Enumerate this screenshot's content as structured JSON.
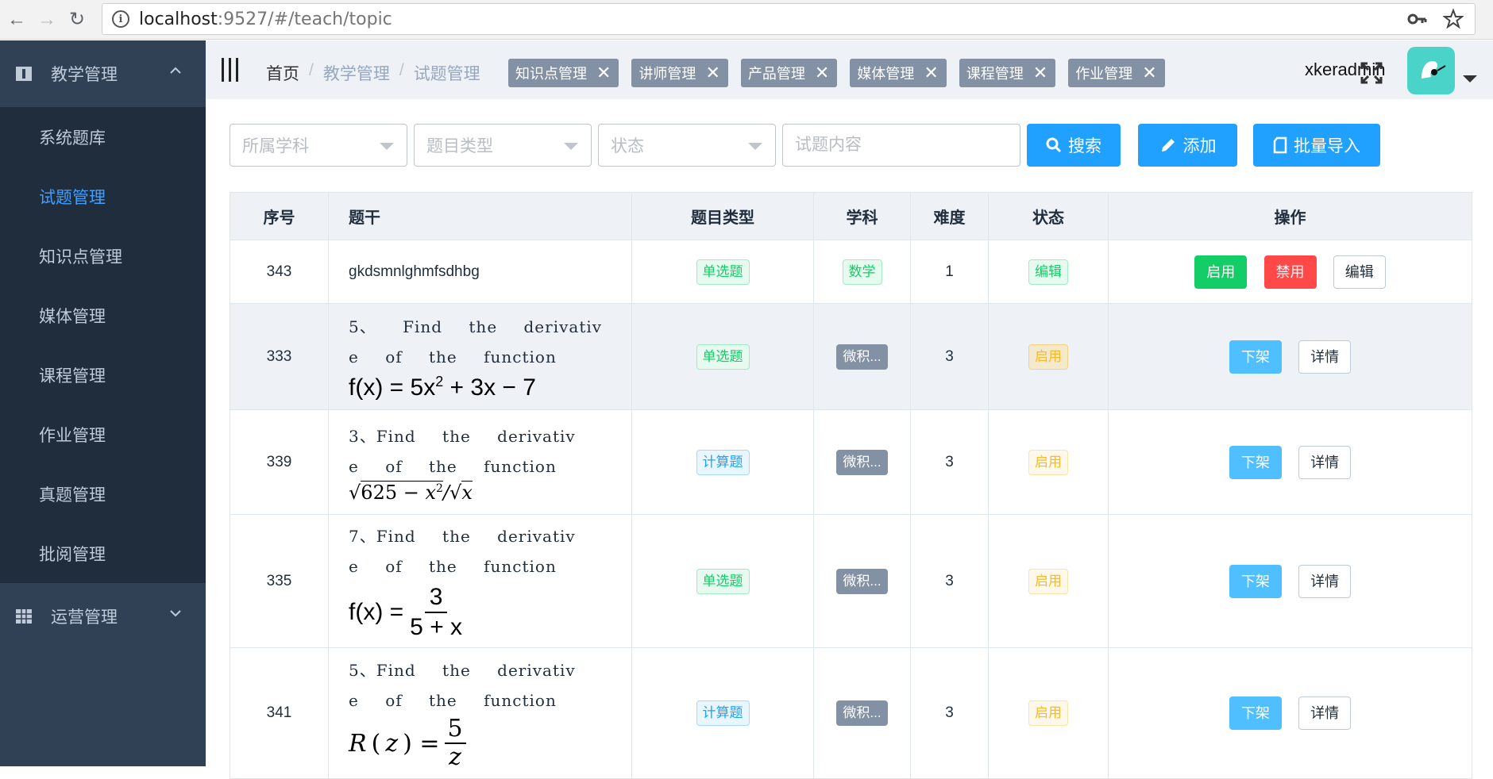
{
  "browser": {
    "url_host": "localhost",
    "url_rest": ":9527/#/teach/topic"
  },
  "sidebar": {
    "groups": [
      {
        "label": "教学管理",
        "icon": "info-box-icon",
        "expanded": true,
        "items": [
          {
            "label": "系统题库",
            "active": false
          },
          {
            "label": "试题管理",
            "active": true
          },
          {
            "label": "知识点管理",
            "active": false
          },
          {
            "label": "媒体管理",
            "active": false
          },
          {
            "label": "课程管理",
            "active": false
          },
          {
            "label": "作业管理",
            "active": false
          },
          {
            "label": "真题管理",
            "active": false
          },
          {
            "label": "批阅管理",
            "active": false
          }
        ]
      },
      {
        "label": "运营管理",
        "icon": "grid-icon",
        "expanded": false
      }
    ]
  },
  "header": {
    "breadcrumb": [
      "首页",
      "教学管理",
      "试题管理"
    ],
    "tags": [
      "知识点管理",
      "讲师管理",
      "产品管理",
      "媒体管理",
      "课程管理",
      "作业管理"
    ],
    "username": "xkeradmin"
  },
  "filters": {
    "subject_placeholder": "所属学科",
    "type_placeholder": "题目类型",
    "status_placeholder": "状态",
    "content_placeholder": "试题内容",
    "search_label": "搜索",
    "add_label": "添加",
    "import_label": "批量导入"
  },
  "table": {
    "headers": [
      "序号",
      "题干",
      "题目类型",
      "学科",
      "难度",
      "状态",
      "操作"
    ],
    "rows": [
      {
        "id": "343",
        "stem_line1": "gkdsmnlghmfsdhbg",
        "type": "单选题",
        "subject": "数学",
        "difficulty": "1",
        "status": "编辑",
        "actions": [
          "启用",
          "禁用",
          "编辑"
        ]
      },
      {
        "id": "333",
        "stem_line1": "5、 Find the derivativ",
        "stem_line2": "e of the function",
        "formula": "f(x) = 5x² + 3x − 7",
        "type": "单选题",
        "subject": "微积...",
        "difficulty": "3",
        "status": "启用",
        "actions": [
          "下架",
          "详情"
        ]
      },
      {
        "id": "339",
        "stem_line1": "3、Find the derivativ",
        "stem_line2": "e of the function",
        "formula": "√(625 − x²)/√x",
        "type": "计算题",
        "subject": "微积...",
        "difficulty": "3",
        "status": "启用",
        "actions": [
          "下架",
          "详情"
        ]
      },
      {
        "id": "335",
        "stem_line1": "7、Find the derivativ",
        "stem_line2": "e of the function",
        "formula": "f(x) = 3 / (5 + x)",
        "type": "单选题",
        "subject": "微积...",
        "difficulty": "3",
        "status": "启用",
        "actions": [
          "下架",
          "详情"
        ]
      },
      {
        "id": "341",
        "stem_line1": "5、Find the derivativ",
        "stem_line2": "e of the function",
        "formula": "R(z) = 5 / z",
        "type": "计算题",
        "subject": "微积...",
        "difficulty": "3",
        "status": "启用",
        "actions": [
          "下架",
          "详情"
        ]
      }
    ]
  }
}
